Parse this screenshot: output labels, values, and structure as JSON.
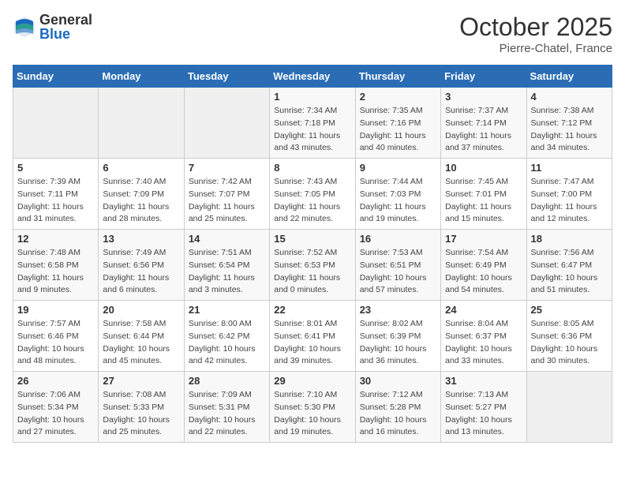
{
  "header": {
    "logo_line1": "General",
    "logo_line2": "Blue",
    "title": "October 2025",
    "subtitle": "Pierre-Chatel, France"
  },
  "weekdays": [
    "Sunday",
    "Monday",
    "Tuesday",
    "Wednesday",
    "Thursday",
    "Friday",
    "Saturday"
  ],
  "weeks": [
    [
      {
        "day": "",
        "info": ""
      },
      {
        "day": "",
        "info": ""
      },
      {
        "day": "",
        "info": ""
      },
      {
        "day": "1",
        "info": "Sunrise: 7:34 AM\nSunset: 7:18 PM\nDaylight: 11 hours and 43 minutes."
      },
      {
        "day": "2",
        "info": "Sunrise: 7:35 AM\nSunset: 7:16 PM\nDaylight: 11 hours and 40 minutes."
      },
      {
        "day": "3",
        "info": "Sunrise: 7:37 AM\nSunset: 7:14 PM\nDaylight: 11 hours and 37 minutes."
      },
      {
        "day": "4",
        "info": "Sunrise: 7:38 AM\nSunset: 7:12 PM\nDaylight: 11 hours and 34 minutes."
      }
    ],
    [
      {
        "day": "5",
        "info": "Sunrise: 7:39 AM\nSunset: 7:11 PM\nDaylight: 11 hours and 31 minutes."
      },
      {
        "day": "6",
        "info": "Sunrise: 7:40 AM\nSunset: 7:09 PM\nDaylight: 11 hours and 28 minutes."
      },
      {
        "day": "7",
        "info": "Sunrise: 7:42 AM\nSunset: 7:07 PM\nDaylight: 11 hours and 25 minutes."
      },
      {
        "day": "8",
        "info": "Sunrise: 7:43 AM\nSunset: 7:05 PM\nDaylight: 11 hours and 22 minutes."
      },
      {
        "day": "9",
        "info": "Sunrise: 7:44 AM\nSunset: 7:03 PM\nDaylight: 11 hours and 19 minutes."
      },
      {
        "day": "10",
        "info": "Sunrise: 7:45 AM\nSunset: 7:01 PM\nDaylight: 11 hours and 15 minutes."
      },
      {
        "day": "11",
        "info": "Sunrise: 7:47 AM\nSunset: 7:00 PM\nDaylight: 11 hours and 12 minutes."
      }
    ],
    [
      {
        "day": "12",
        "info": "Sunrise: 7:48 AM\nSunset: 6:58 PM\nDaylight: 11 hours and 9 minutes."
      },
      {
        "day": "13",
        "info": "Sunrise: 7:49 AM\nSunset: 6:56 PM\nDaylight: 11 hours and 6 minutes."
      },
      {
        "day": "14",
        "info": "Sunrise: 7:51 AM\nSunset: 6:54 PM\nDaylight: 11 hours and 3 minutes."
      },
      {
        "day": "15",
        "info": "Sunrise: 7:52 AM\nSunset: 6:53 PM\nDaylight: 11 hours and 0 minutes."
      },
      {
        "day": "16",
        "info": "Sunrise: 7:53 AM\nSunset: 6:51 PM\nDaylight: 10 hours and 57 minutes."
      },
      {
        "day": "17",
        "info": "Sunrise: 7:54 AM\nSunset: 6:49 PM\nDaylight: 10 hours and 54 minutes."
      },
      {
        "day": "18",
        "info": "Sunrise: 7:56 AM\nSunset: 6:47 PM\nDaylight: 10 hours and 51 minutes."
      }
    ],
    [
      {
        "day": "19",
        "info": "Sunrise: 7:57 AM\nSunset: 6:46 PM\nDaylight: 10 hours and 48 minutes."
      },
      {
        "day": "20",
        "info": "Sunrise: 7:58 AM\nSunset: 6:44 PM\nDaylight: 10 hours and 45 minutes."
      },
      {
        "day": "21",
        "info": "Sunrise: 8:00 AM\nSunset: 6:42 PM\nDaylight: 10 hours and 42 minutes."
      },
      {
        "day": "22",
        "info": "Sunrise: 8:01 AM\nSunset: 6:41 PM\nDaylight: 10 hours and 39 minutes."
      },
      {
        "day": "23",
        "info": "Sunrise: 8:02 AM\nSunset: 6:39 PM\nDaylight: 10 hours and 36 minutes."
      },
      {
        "day": "24",
        "info": "Sunrise: 8:04 AM\nSunset: 6:37 PM\nDaylight: 10 hours and 33 minutes."
      },
      {
        "day": "25",
        "info": "Sunrise: 8:05 AM\nSunset: 6:36 PM\nDaylight: 10 hours and 30 minutes."
      }
    ],
    [
      {
        "day": "26",
        "info": "Sunrise: 7:06 AM\nSunset: 5:34 PM\nDaylight: 10 hours and 27 minutes."
      },
      {
        "day": "27",
        "info": "Sunrise: 7:08 AM\nSunset: 5:33 PM\nDaylight: 10 hours and 25 minutes."
      },
      {
        "day": "28",
        "info": "Sunrise: 7:09 AM\nSunset: 5:31 PM\nDaylight: 10 hours and 22 minutes."
      },
      {
        "day": "29",
        "info": "Sunrise: 7:10 AM\nSunset: 5:30 PM\nDaylight: 10 hours and 19 minutes."
      },
      {
        "day": "30",
        "info": "Sunrise: 7:12 AM\nSunset: 5:28 PM\nDaylight: 10 hours and 16 minutes."
      },
      {
        "day": "31",
        "info": "Sunrise: 7:13 AM\nSunset: 5:27 PM\nDaylight: 10 hours and 13 minutes."
      },
      {
        "day": "",
        "info": ""
      }
    ]
  ]
}
